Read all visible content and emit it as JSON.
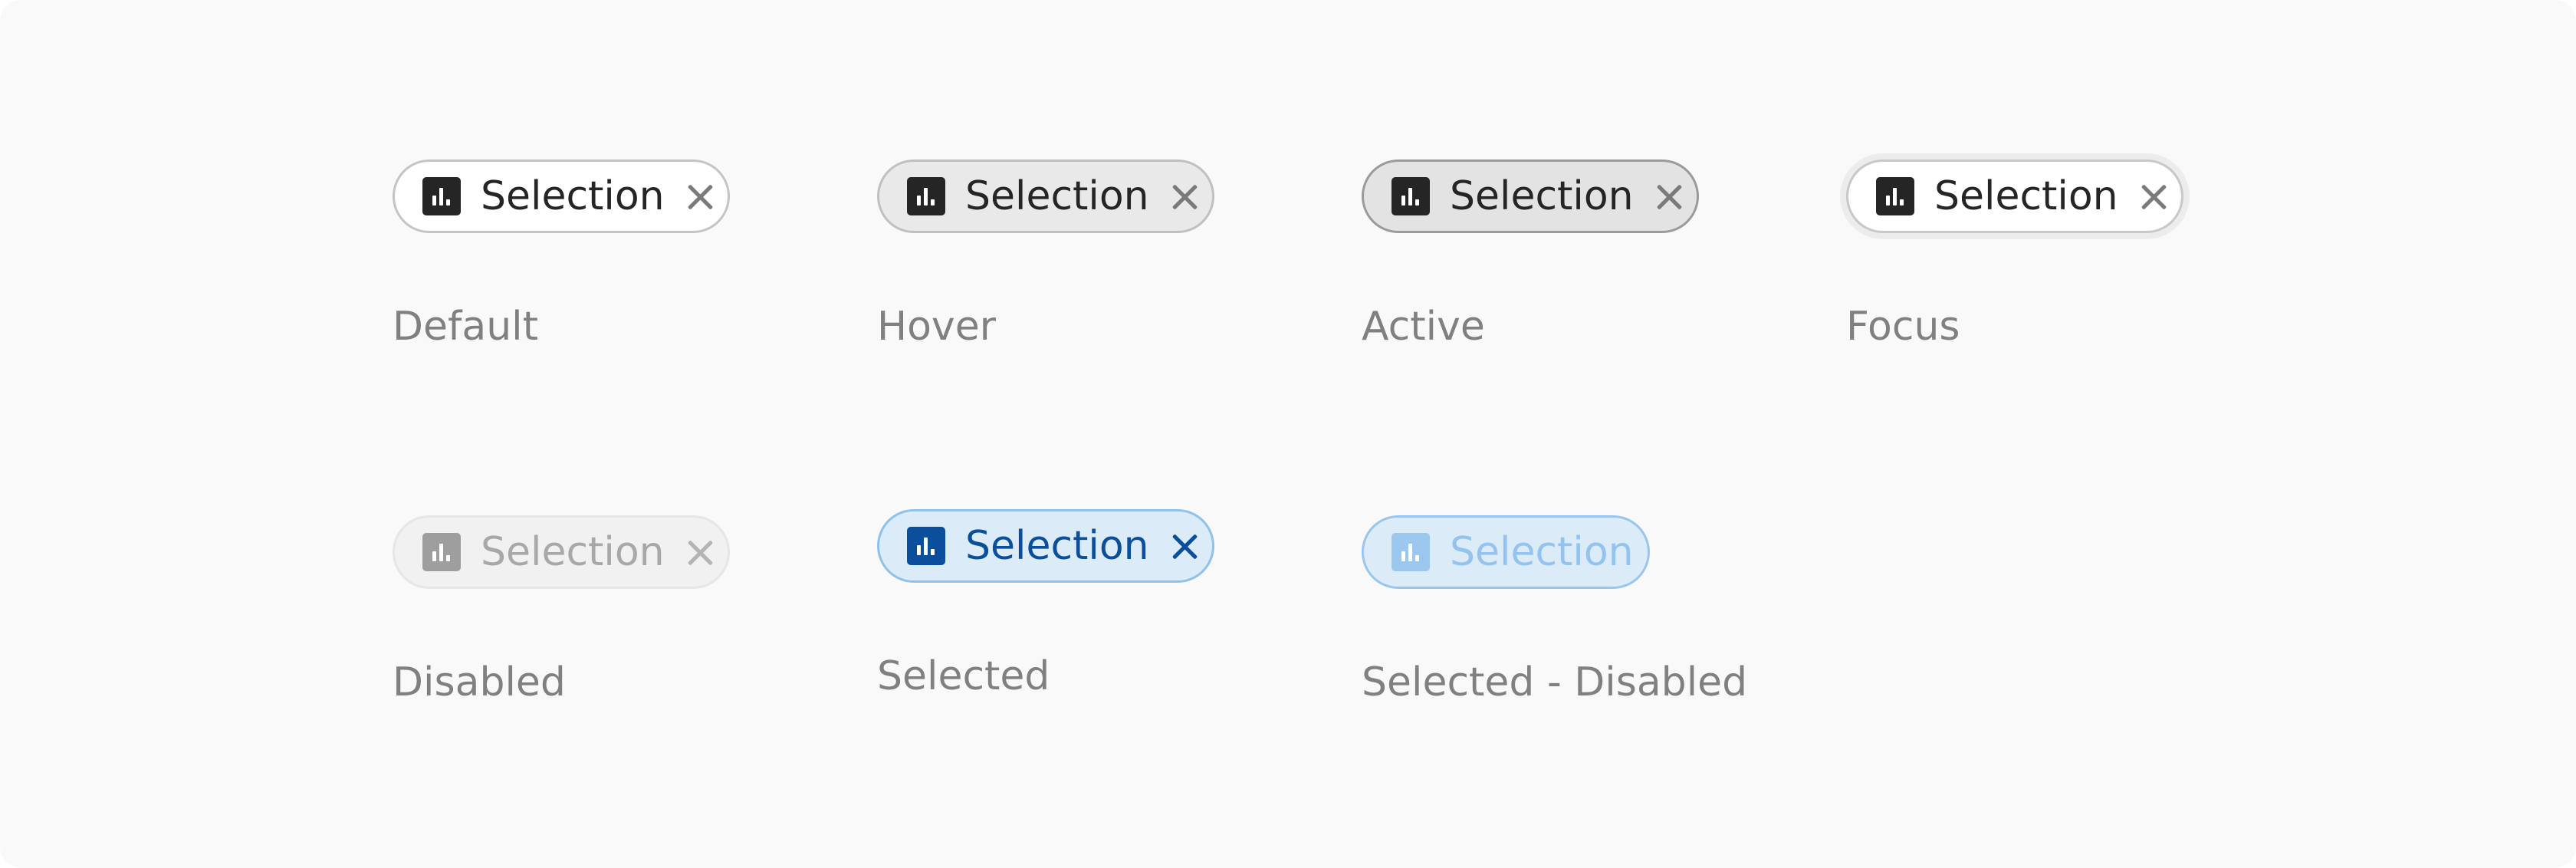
{
  "states": [
    {
      "key": "default",
      "chip_label": "Selection",
      "caption": "Default",
      "closable": true
    },
    {
      "key": "hover",
      "chip_label": "Selection",
      "caption": "Hover",
      "closable": true
    },
    {
      "key": "active",
      "chip_label": "Selection",
      "caption": "Active",
      "closable": true
    },
    {
      "key": "focus",
      "chip_label": "Selection",
      "caption": "Focus",
      "closable": true
    },
    {
      "key": "disabled",
      "chip_label": "Selection",
      "caption": "Disabled",
      "closable": true
    },
    {
      "key": "selected",
      "chip_label": "Selection",
      "caption": "Selected",
      "closable": true
    },
    {
      "key": "selected-disabled",
      "chip_label": "Selection",
      "caption": "Selected - Disabled",
      "closable": false
    }
  ],
  "icons": {
    "chip_icon": "bar-chart-icon",
    "close_icon": "close-icon"
  },
  "colors": {
    "background": "#f9f9f9",
    "chip_text": "#252525",
    "caption_text": "#808080",
    "selected_accent": "#0b4f9c",
    "selected_fill": "#dcebf8",
    "selected_border": "#8ec1ec"
  }
}
